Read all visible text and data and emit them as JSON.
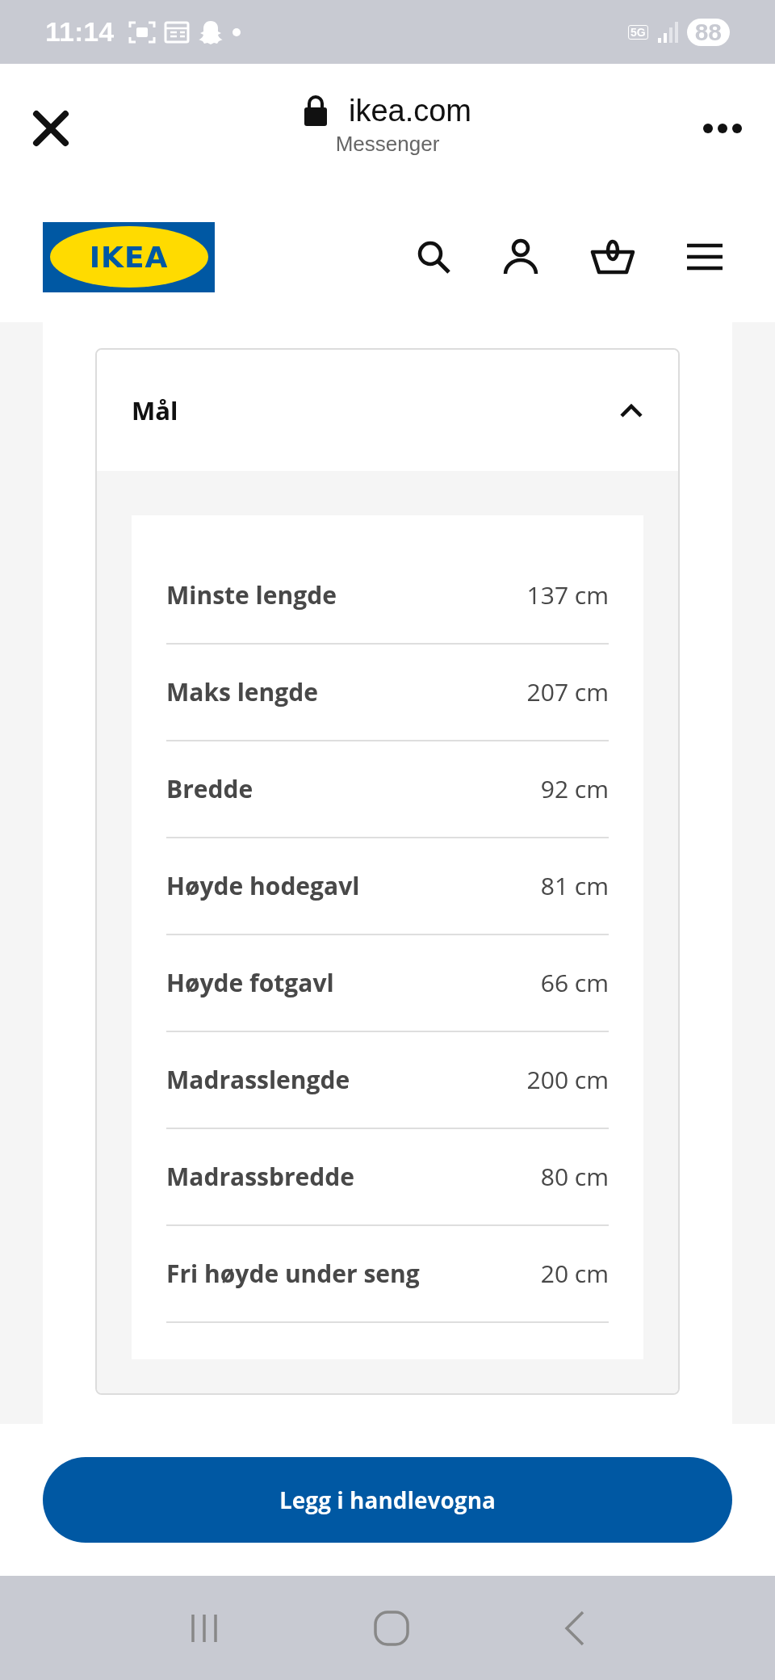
{
  "status_bar": {
    "time": "11:14",
    "network": "5G",
    "battery": "88"
  },
  "browser": {
    "domain": "ikea.com",
    "subtitle": "Messenger"
  },
  "site_header": {
    "logo": "IKEA"
  },
  "accordion": {
    "title": "Mål",
    "expanded": true,
    "rows": [
      {
        "label": "Minste lengde",
        "value": "137 cm"
      },
      {
        "label": "Maks lengde",
        "value": "207 cm"
      },
      {
        "label": "Bredde",
        "value": "92 cm"
      },
      {
        "label": "Høyde hodegavl",
        "value": "81 cm"
      },
      {
        "label": "Høyde fotgavl",
        "value": "66 cm"
      },
      {
        "label": "Madrasslengde",
        "value": "200 cm"
      },
      {
        "label": "Madrassbredde",
        "value": "80 cm"
      },
      {
        "label": "Fri høyde under seng",
        "value": "20 cm"
      }
    ]
  },
  "primary_button": "Legg i handlevogna"
}
